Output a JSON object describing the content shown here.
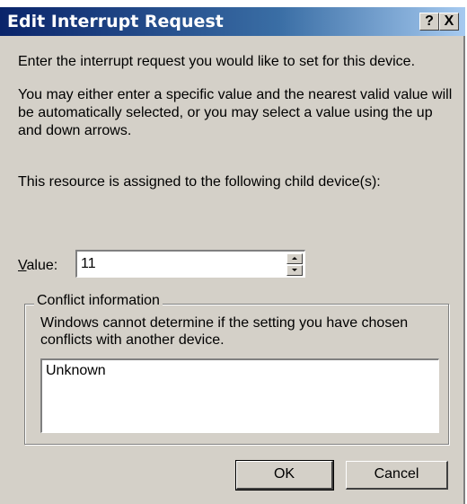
{
  "window": {
    "title": "Edit Interrupt Request",
    "help_glyph": "?",
    "close_glyph": "X"
  },
  "body": {
    "intro": "Enter the interrupt request you would like to set for this device.",
    "instructions": "You may either enter a specific value and the nearest valid value will be automatically selected, or you may select a value using the up and down arrows.",
    "assigned": "This resource is assigned to the following child device(s):"
  },
  "value": {
    "label_underlined": "V",
    "label_rest": "alue:",
    "current": "11"
  },
  "conflict": {
    "legend": "Conflict information",
    "message": "Windows cannot determine if the setting you have chosen conflicts with another device.",
    "details": "Unknown"
  },
  "buttons": {
    "ok": "OK",
    "cancel": "Cancel"
  },
  "colors": {
    "dialog_bg": "#d4d0c8",
    "title_start": "#0a246a",
    "title_end": "#a6caf0"
  }
}
